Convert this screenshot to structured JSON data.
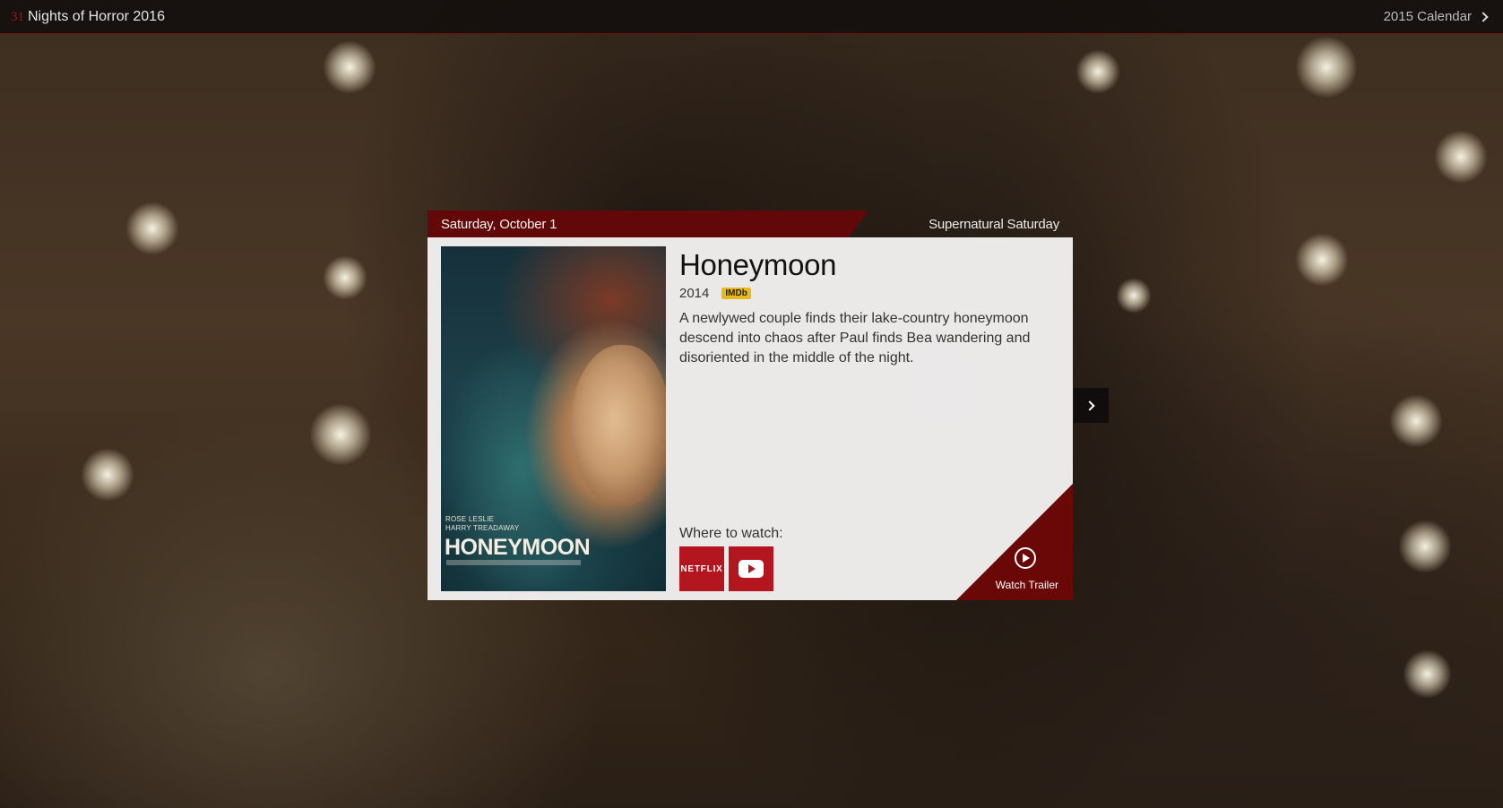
{
  "topbar": {
    "brand_number": "31",
    "brand_text": "Nights of Horror 2016",
    "calendar_link": "2015 Calendar"
  },
  "card": {
    "date": "Saturday, October 1",
    "theme": "Supernatural Saturday",
    "movie": {
      "title": "Honeymoon",
      "year": "2014",
      "imdb_label": "IMDb",
      "description": "A newlywed couple finds their lake-country honeymoon descend into chaos after Paul finds Bea wandering and disoriented in the middle of the night."
    },
    "poster": {
      "cast_line_1": "ROSE LESLIE",
      "cast_line_2": "HARRY TREADAWAY",
      "title": "HONEYMOON"
    },
    "where_to_watch": {
      "label": "Where to watch:",
      "services": [
        {
          "name": "NETFLIX",
          "icon": "netflix-logo",
          "color": "#b3161f"
        },
        {
          "name": "YouTube",
          "icon": "youtube-play-icon",
          "color": "#b3161f"
        }
      ]
    },
    "trailer": {
      "label": "Watch Trailer",
      "icon": "play-circle-icon"
    }
  },
  "navigation": {
    "next_icon": "chevron-right-icon"
  },
  "colors": {
    "accent": "#630808",
    "topbar_border": "#7a0c0c",
    "imdb": "#e8b91b"
  }
}
